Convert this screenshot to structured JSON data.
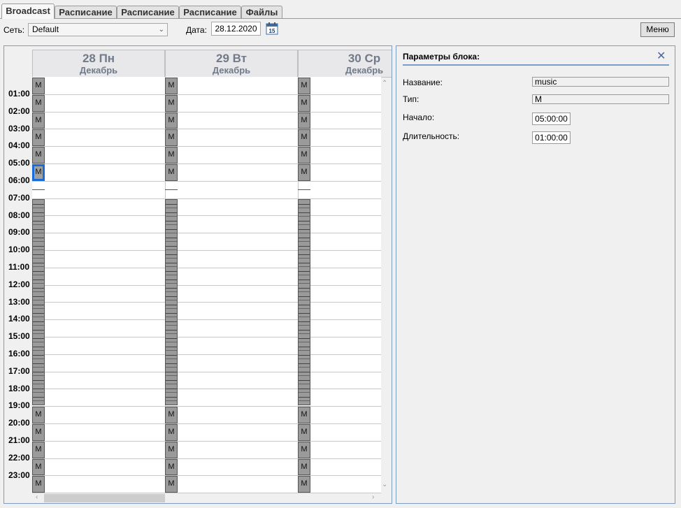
{
  "tabs": [
    {
      "label": "Broadcast",
      "active": true
    },
    {
      "label": "Расписание",
      "active": false
    },
    {
      "label": "Расписание",
      "active": false
    },
    {
      "label": "Расписание",
      "active": false
    },
    {
      "label": "Файлы",
      "active": false
    }
  ],
  "toolbar": {
    "network_label": "Сеть:",
    "network_value": "Default",
    "date_label": "Дата:",
    "date_value": "28.12.2020",
    "calendar_day": "15",
    "menu_label": "Меню"
  },
  "calendar": {
    "days": [
      {
        "day": "28 Пн",
        "month": "Декабрь"
      },
      {
        "day": "29 Вт",
        "month": "Декабрь"
      },
      {
        "day": "30 Ср",
        "month": "Декабрь"
      }
    ],
    "hours": [
      "01:00",
      "02:00",
      "03:00",
      "04:00",
      "05:00",
      "06:00",
      "07:00",
      "08:00",
      "09:00",
      "10:00",
      "11:00",
      "12:00",
      "13:00",
      "14:00",
      "15:00",
      "16:00",
      "17:00",
      "18:00",
      "19:00",
      "20:00",
      "21:00",
      "22:00",
      "23:00"
    ],
    "block_label": "M",
    "morning_blocks": [
      "M",
      "M",
      "M",
      "M",
      "M",
      "M"
    ],
    "evening_blocks": [
      "M",
      "M",
      "M",
      "M",
      "M"
    ],
    "selected_block": {
      "day": 0,
      "index": 5
    }
  },
  "params": {
    "title": "Параметры блока:",
    "name_label": "Название:",
    "name_value": "music",
    "type_label": "Тип:",
    "type_value": "M",
    "start_label": "Начало:",
    "start_value": "05:00:00",
    "duration_label": "Длительность:",
    "duration_value": "01:00:00"
  },
  "colors": {
    "accent": "#1b6bd8",
    "panel_border": "#7a9cc5",
    "block": "#9a9a9a"
  }
}
